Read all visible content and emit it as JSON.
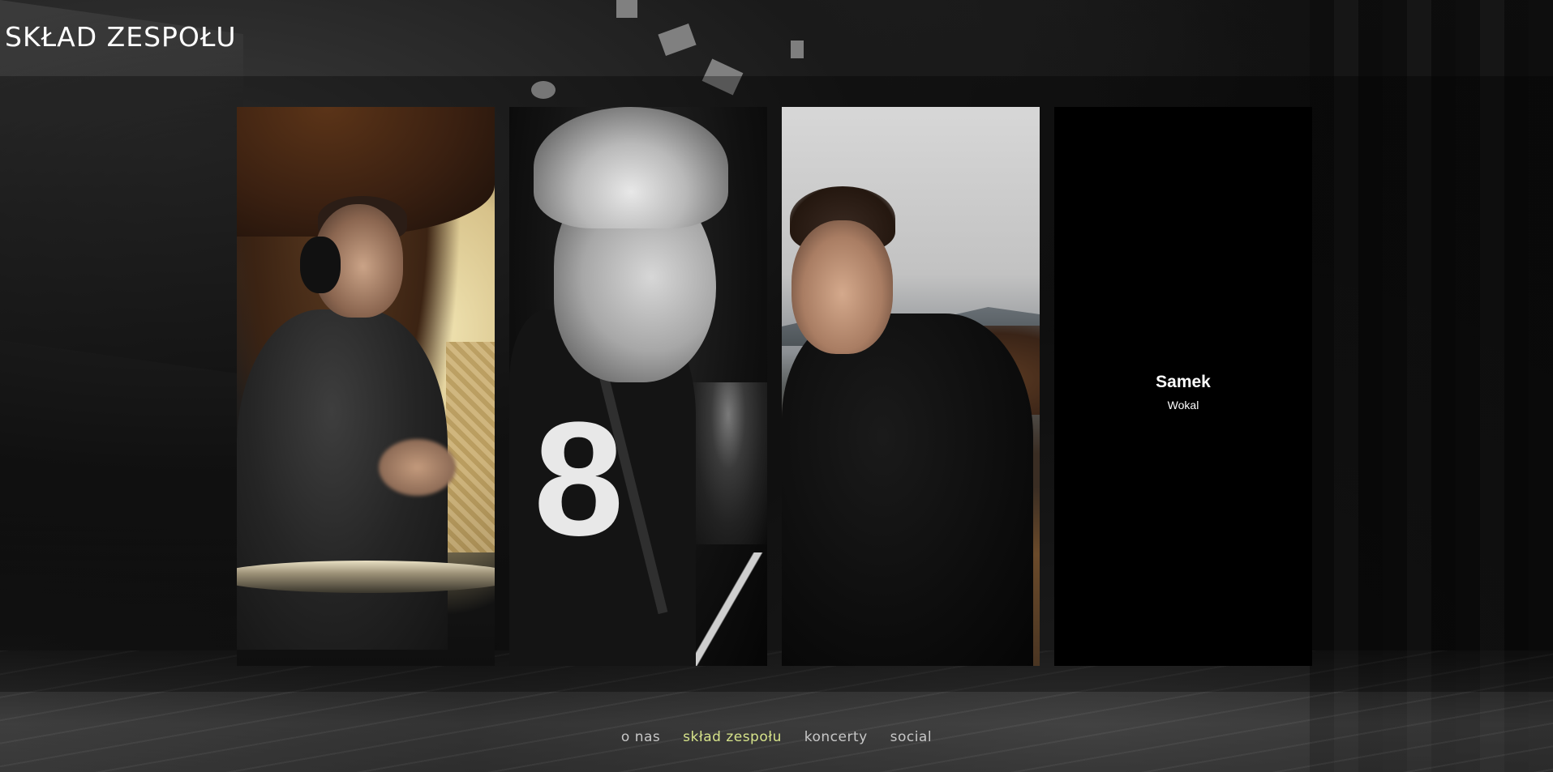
{
  "header": {
    "title": "SKŁAD ZESPOŁU"
  },
  "members": [
    {
      "photo_alt": "drummer-photo"
    },
    {
      "photo_alt": "guitarist-photo"
    },
    {
      "photo_alt": "portrait-photo"
    },
    {
      "name": "Samek",
      "role": "Wokal"
    }
  ],
  "nav": {
    "items": [
      {
        "label": "o nas",
        "active": false
      },
      {
        "label": "skład zespołu",
        "active": true
      },
      {
        "label": "koncerty",
        "active": false
      },
      {
        "label": "social",
        "active": false
      }
    ]
  },
  "colors": {
    "active_nav": "#d6e38a",
    "nav_text": "#c7c7c7",
    "title_text": "#ffffff"
  }
}
